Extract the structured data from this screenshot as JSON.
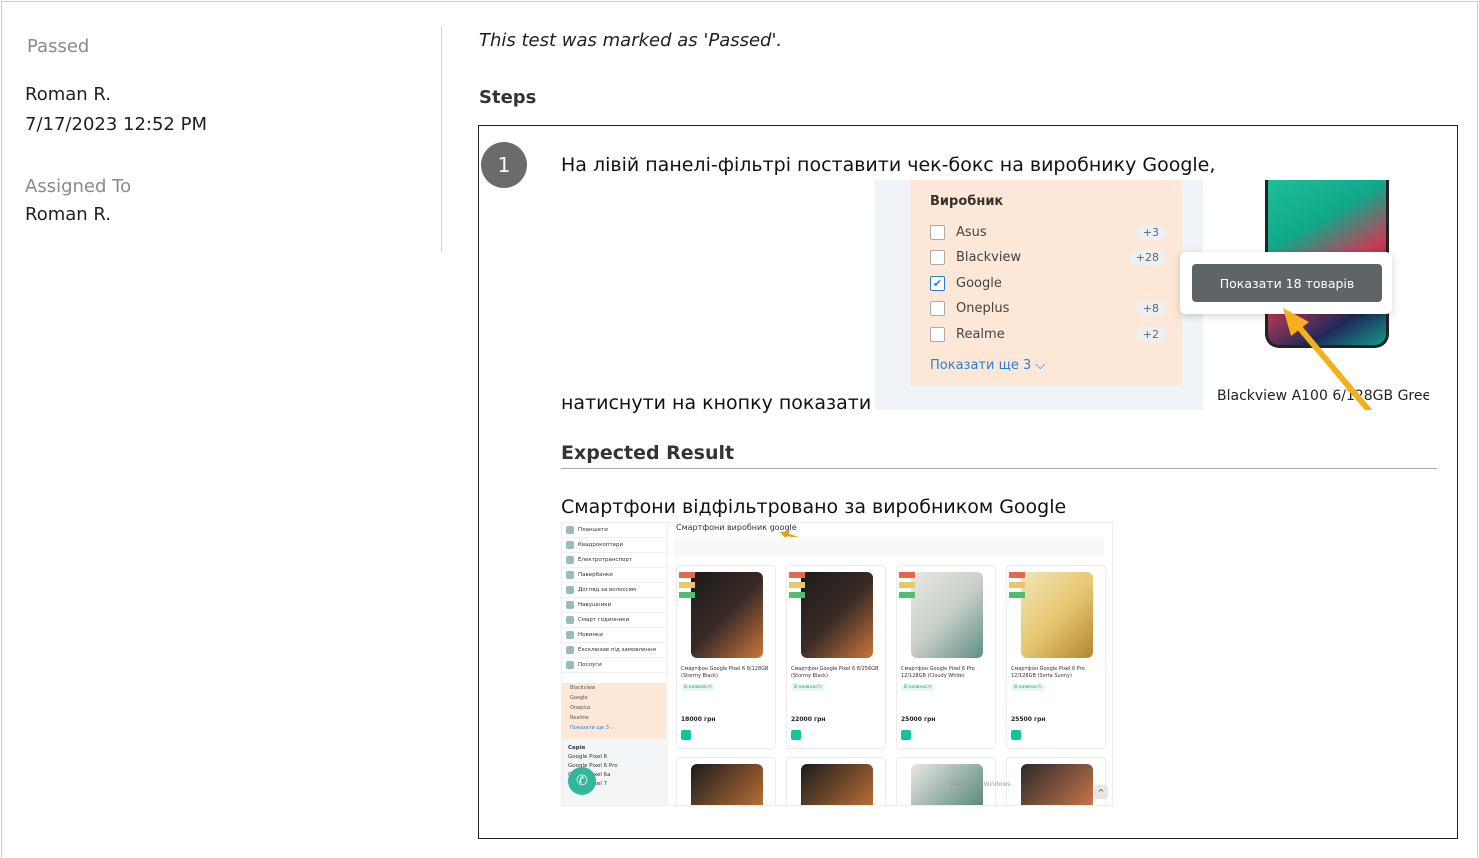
{
  "sidebar": {
    "status": "Passed",
    "author": "Roman R.",
    "date": "7/17/2023 12:52 PM",
    "assigned_label": "Assigned To",
    "assigned_value": "Roman R."
  },
  "main": {
    "note": "This test was marked as 'Passed'.",
    "steps_heading": "Steps"
  },
  "step": {
    "number": "1",
    "text_line1": "На лівій панелі-фільтрі поставити чек-бокс на виробнику Google,",
    "text_line2": "натиснути на кнопку показати",
    "expected_heading": "Expected Result",
    "expected_text": "Смартфони відфільтровано за виробником Google"
  },
  "shot1": {
    "filter_title": "Виробник",
    "brands": [
      {
        "name": "Asus",
        "badge": "+3",
        "checked": false
      },
      {
        "name": "Blackview",
        "badge": "+28",
        "checked": false
      },
      {
        "name": "Google",
        "badge": "",
        "checked": true
      },
      {
        "name": "Oneplus",
        "badge": "+8",
        "checked": false
      },
      {
        "name": "Realme",
        "badge": "+2",
        "checked": false
      }
    ],
    "show_more": "Показати ще 3 ⌵",
    "popup_button": "Показати 18 товарів",
    "product_caption": "Blackview A100 6/128GB Gree"
  },
  "shot2": {
    "page_title": "Смартфони виробник google",
    "menu": [
      "Планшети",
      "Квадрокоптери",
      "Електротранспорт",
      "Павербанки",
      "Догляд за волоссям",
      "Навушники",
      "Смарт годинники",
      "Новинки",
      "Ексклюзив під замовлення",
      "Послуги"
    ],
    "filter_items": [
      "Blackview",
      "Google",
      "Oneplus",
      "Realme",
      "Показати ще 3 ⌵"
    ],
    "series_title": "Серія",
    "series": [
      "Google Pixel 6",
      "Google Pixel 6 Pro",
      "Google Pixel 6a",
      "Google Pixel 7"
    ],
    "products": [
      {
        "name": "Смартфон Google Pixel 6 8/128GB (Stormy Black)",
        "stock": "В наявності",
        "price": "18000 грн"
      },
      {
        "name": "Смартфон Google Pixel 6 8/256GB (Stormy Black)",
        "stock": "В наявності",
        "price": "22000 грн"
      },
      {
        "name": "Смартфон Google Pixel 6 Pro 12/128GB (Cloudy White)",
        "stock": "В наявності",
        "price": "25000 грн"
      },
      {
        "name": "Смартфон Google Pixel 6 Pro 12/128GB (Sorta Sunny)",
        "stock": "В наявності",
        "price": "25500 грн"
      }
    ],
    "watermark": "Активація Windows"
  }
}
